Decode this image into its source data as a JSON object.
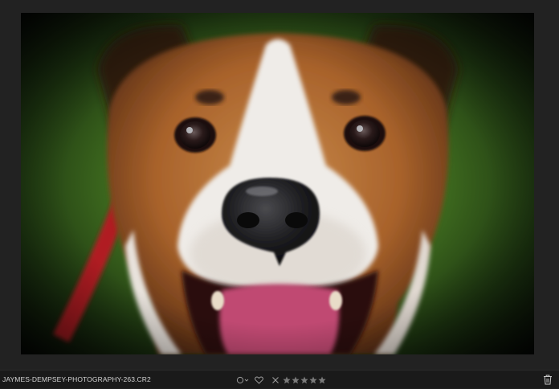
{
  "viewer": {
    "photo_subject": "dog-portrait"
  },
  "bottom_bar": {
    "filename": "JAYMES-DEMPSEY-PHOTOGRAPHY-263.CR2",
    "color_label_icon": "color-label-icon",
    "favorite_icon": "heart-icon",
    "reject_icon": "close-icon",
    "rating": {
      "value": 0,
      "max": 5
    },
    "delete_icon": "trash-icon"
  },
  "colors": {
    "bar_bg": "#1a1a1a",
    "viewer_bg": "#222222",
    "icon": "#9c9c9c",
    "filename_text": "#d2d2d2"
  }
}
